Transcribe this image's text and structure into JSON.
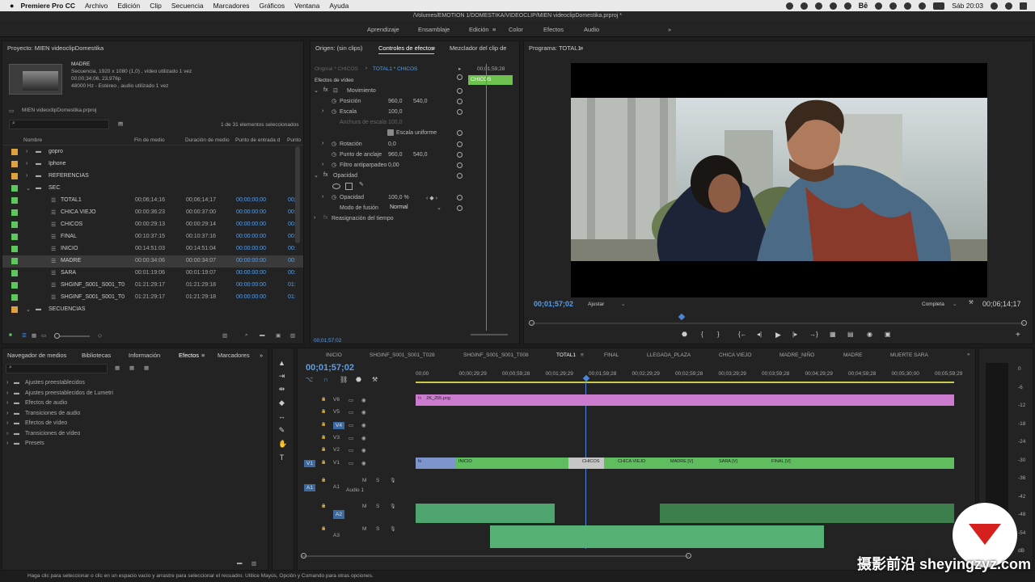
{
  "menubar": {
    "apple": "",
    "app": "Premiere Pro CC",
    "items": [
      "Archivo",
      "Edición",
      "Clip",
      "Secuencia",
      "Marcadores",
      "Gráficos",
      "Ventana",
      "Ayuda"
    ],
    "clock": "Sáb 20:03",
    "be_label": "Bē"
  },
  "window_title": "/Volumes/EMOTION 1/DOMESTIKA/VIDEOCLIP/MIEN videoclipDomestika.prproj *",
  "workspaces": [
    "Aprendizaje",
    "Ensamblaje",
    "Edición",
    "Color",
    "Efectos",
    "Audio"
  ],
  "workspace_more": "»",
  "project": {
    "title": "Proyecto: MIEN videoclipDomestika",
    "clip_name": "MADRE",
    "clip_info": [
      "Secuencia, 1920 x 1080 (1,0) , vídeo utilizado 1 vez",
      "00;00;34;06, 23,976p",
      "48000 Hz - Estéreo , audio utilizado 1 vez"
    ],
    "file": "MIEN videoclipDomestika.prproj",
    "selection": "1 de 31 elementos seleccionados",
    "columns": [
      "Nombre",
      "Fin de medio",
      "Duración de medio",
      "Punto de entrada d",
      "Punto"
    ],
    "rows": [
      {
        "name": "gopro",
        "c1": "",
        "c2": "",
        "c3": "",
        "c4": "",
        "color": "#e0a040",
        "folder": true,
        "indent": 0
      },
      {
        "name": "Iphone",
        "c1": "",
        "c2": "",
        "c3": "",
        "c4": "",
        "color": "#e0a040",
        "folder": true,
        "indent": 0
      },
      {
        "name": "REFERENCIAS",
        "c1": "",
        "c2": "",
        "c3": "",
        "c4": "",
        "color": "#e0a040",
        "folder": true,
        "indent": 0
      },
      {
        "name": "SEC",
        "c1": "",
        "c2": "",
        "c3": "",
        "c4": "",
        "color": "#5cc85c",
        "folder": true,
        "indent": 0
      },
      {
        "name": "TOTAL1",
        "c1": "00;06;14;16",
        "c2": "00;06;14;17",
        "c3": "00;00;00;00",
        "c4": "00;",
        "color": "#5cc85c",
        "folder": false,
        "indent": 1
      },
      {
        "name": "CHICA VIEJO",
        "c1": "00:00:36:23",
        "c2": "00:00:37:00",
        "c3": "00:00:00:00",
        "c4": "00:",
        "color": "#5cc85c",
        "folder": false,
        "indent": 1
      },
      {
        "name": "CHICOS",
        "c1": "00:00:29:13",
        "c2": "00:00:29:14",
        "c3": "00:00:00:00",
        "c4": "00:",
        "color": "#5cc85c",
        "folder": false,
        "indent": 1
      },
      {
        "name": "FINAL",
        "c1": "00:10:37:15",
        "c2": "00:10:37:16",
        "c3": "00:00:00:00",
        "c4": "00:",
        "color": "#5cc85c",
        "folder": false,
        "indent": 1
      },
      {
        "name": "INICIO",
        "c1": "00:14:51:03",
        "c2": "00:14:51:04",
        "c3": "00:00:00:00",
        "c4": "00:",
        "color": "#5cc85c",
        "folder": false,
        "indent": 1
      },
      {
        "name": "MADRE",
        "c1": "00:00:34:06",
        "c2": "00:00:34:07",
        "c3": "00:00:00:00",
        "c4": "00:",
        "color": "#5cc85c",
        "folder": false,
        "indent": 1,
        "selected": true
      },
      {
        "name": "SARA",
        "c1": "00:01:19:06",
        "c2": "00:01:19:07",
        "c3": "00:00:00:00",
        "c4": "00:",
        "color": "#5cc85c",
        "folder": false,
        "indent": 1
      },
      {
        "name": "SHGINF_S001_S001_T0",
        "c1": "01:21:29:17",
        "c2": "01:21:29:18",
        "c3": "00:00:00:00",
        "c4": "01:",
        "color": "#5cc85c",
        "folder": false,
        "indent": 1
      },
      {
        "name": "SHGINF_S001_S001_T0",
        "c1": "01:21:29:17",
        "c2": "01:21:29:18",
        "c3": "00:00:00:00",
        "c4": "01:",
        "color": "#5cc85c",
        "folder": false,
        "indent": 1
      },
      {
        "name": "SECUENCIAS",
        "c1": "",
        "c2": "",
        "c3": "",
        "c4": "",
        "color": "#e0a040",
        "folder": true,
        "indent": 0
      }
    ]
  },
  "effects_panel": {
    "tabs": [
      "Navegador de medios",
      "Bibliotecas",
      "Información",
      "Efectos",
      "Marcadores"
    ],
    "more": "»",
    "items": [
      "Ajustes preestablecidos",
      "Ajustes preestablecidos de Lumetri",
      "Efectos de audio",
      "Transiciones de audio",
      "Efectos de vídeo",
      "Transiciones de vídeo",
      "Presets"
    ]
  },
  "effect_controls": {
    "tabs": [
      "Origen: (sin clips)",
      "Controles de efectos",
      "Mezclador del clip de"
    ],
    "source_label": "Original * CHICOS",
    "seq_label": "TOTAL1 * CHICOS",
    "timecode_top": "00;01;59;28",
    "clip_tag": "CHICOS",
    "section": "Efectos de vídeo",
    "movimiento": "Movimiento",
    "posicion": "Posición",
    "pos_x": "960,0",
    "pos_y": "540,0",
    "escala": "Escala",
    "escala_val": "100,0",
    "anchura": "Anchura de escala",
    "anchura_val": "100,0",
    "escala_uniforme": "Escala uniforme",
    "rotacion": "Rotación",
    "rotacion_val": "0,0",
    "anclaje": "Punto de anclaje",
    "anc_x": "960,0",
    "anc_y": "540,0",
    "filtro": "Filtro antiparpadeo",
    "filtro_val": "0,00",
    "opacidad_section": "Opacidad",
    "opacidad": "Opacidad",
    "opacidad_val": "100,0 %",
    "fusion": "Modo de fusión",
    "fusion_val": "Normal",
    "reasignacion": "Reasignación del tiempo",
    "timecode_bottom": "00;01;57;02"
  },
  "program": {
    "title": "Programa: TOTAL1",
    "timecode": "00;01;57;02",
    "fit": "Ajustar",
    "quality": "Completa",
    "duration": "00;06;14;17",
    "playhead_fraction": 0.3
  },
  "timeline": {
    "tabs": [
      "INICIO",
      "SHGINF_S001_S001_T028",
      "SHGINF_S001_S001_T008",
      "TOTAL1",
      "FINAL",
      "LLEGADA_PLAZA",
      "CHICA VIEJO",
      "MADRE_NIÑO",
      "MADRE",
      "MUERTE SARA"
    ],
    "active_tab": "TOTAL1",
    "timecode": "00;01;57;02",
    "ruler": [
      "00;00",
      "00;00;29;29",
      "00;00;59;28",
      "00;01;29;29",
      "00;01;59;28",
      "00;02;29;29",
      "00;02;59;28",
      "00;03;29;29",
      "00;03;59;28",
      "00;04;29;29",
      "00;04;59;28",
      "00;05;30;00",
      "00;05;59;29"
    ],
    "video_tracks": [
      "V6",
      "V5",
      "V4",
      "V3",
      "V2",
      "V1"
    ],
    "audio_tracks": [
      "A1",
      "A2",
      "A3"
    ],
    "audio1_name": "Audio 1",
    "v6_clip": "2K_255.png",
    "v1_clips": [
      "INICIO",
      "CHICOS",
      "CHICA VIEJO",
      "MADRE [V]",
      "SARA [V]",
      "FINAL [V]"
    ],
    "fx": "fx",
    "meter_labels": [
      "0",
      "-6",
      "-12",
      "-18",
      "-24",
      "-30",
      "-36",
      "-42",
      "-48",
      "-54",
      "dB"
    ],
    "ms": [
      "M",
      "S"
    ]
  },
  "status": "Haga clic para seleccionar o clic en un espacio vacío y arrastre para seleccionar el recuadro. Utilice Mayús, Opción y Comando para otras opciones.",
  "watermark": "摄影前沿 sheyingzyz.com"
}
